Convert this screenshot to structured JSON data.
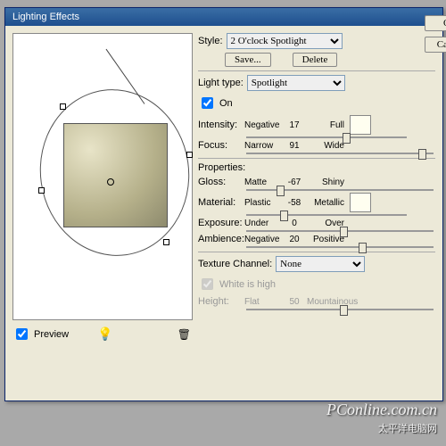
{
  "title": "Lighting Effects",
  "style": {
    "label": "Style:",
    "value": "2 O'clock Spotlight",
    "save": "Save...",
    "del": "Delete"
  },
  "ok": "OK",
  "cancel": "Cancel",
  "light": {
    "type_label": "Light type:",
    "type": "Spotlight",
    "on": "On"
  },
  "sliders": {
    "intensity": {
      "label": "Intensity:",
      "lo": "Negative",
      "hi": "Full",
      "val": "17",
      "pct": 60
    },
    "focus": {
      "label": "Focus:",
      "lo": "Narrow",
      "hi": "Wide",
      "val": "91",
      "pct": 92
    },
    "gloss": {
      "label": "Gloss:",
      "lo": "Matte",
      "hi": "Shiny",
      "val": "-67",
      "pct": 16
    },
    "material": {
      "label": "Material:",
      "lo": "Plastic",
      "hi": "Metallic",
      "val": "-58",
      "pct": 21
    },
    "exposure": {
      "label": "Exposure:",
      "lo": "Under",
      "hi": "Over",
      "val": "0",
      "pct": 50
    },
    "ambience": {
      "label": "Ambience:",
      "lo": "Negative",
      "hi": "Positive",
      "val": "20",
      "pct": 60
    },
    "height": {
      "label": "Height:",
      "lo": "Flat",
      "hi": "Mountainous",
      "val": "50",
      "pct": 50
    }
  },
  "properties": "Properties:",
  "texture": {
    "label": "Texture Channel:",
    "value": "None",
    "white": "White is high"
  },
  "preview": "Preview",
  "watermark": {
    "a": "PConline.com.cn",
    "b": "太平洋电脑网"
  }
}
